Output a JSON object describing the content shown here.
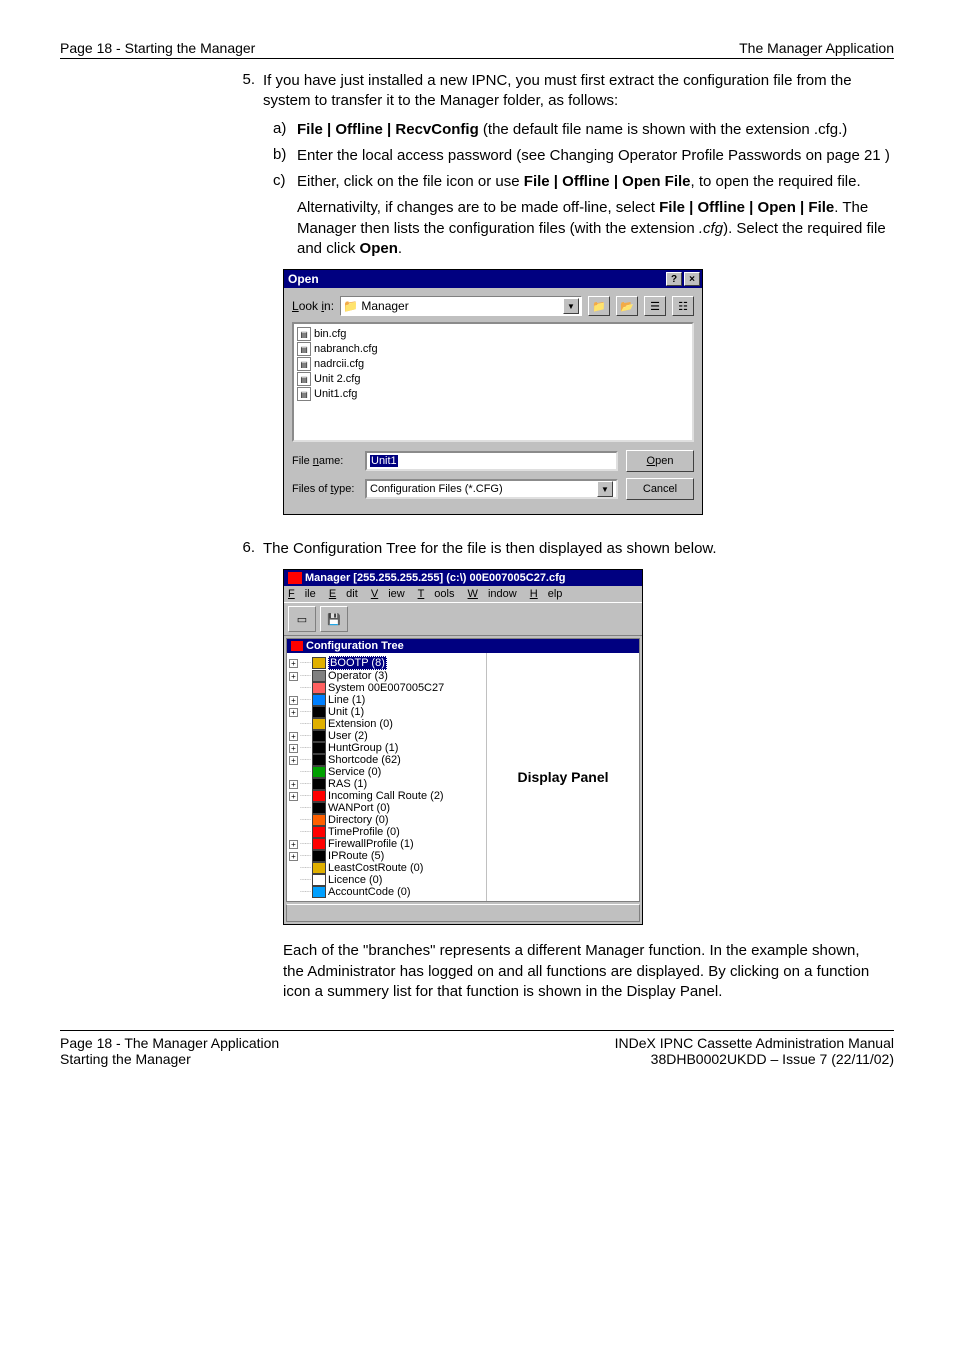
{
  "header": {
    "left": "Page 18 - Starting the Manager",
    "right": "The Manager Application"
  },
  "step5": {
    "num": "5.",
    "intro": "If you have just installed a new IPNC, you must first extract the configuration file from the system to transfer it to the Manager folder, as follows:",
    "a": {
      "letter": "a)",
      "b1": "File | Offline | RecvConfig",
      "rest": " (the default file name is shown with the extension .cfg.)"
    },
    "b": {
      "letter": "b)",
      "text": "Enter the local access password (see Changing Operator Profile Passwords on page 21 )"
    },
    "c": {
      "letter": "c)",
      "pre": "Either, click on the file icon or use ",
      "b1": "File | Offline | Open File",
      "post": ", to open the required file."
    },
    "c2a": "Alternativilty, if changes are to be made off-line, select ",
    "c2b1": "File | Offline | Open | File",
    "c2mid": ". The Manager then lists the configuration files (with the extension ",
    "c2i": ".cfg",
    "c2post": "). Select the required file and click ",
    "c2b2": "Open",
    "c2end": "."
  },
  "openDialog": {
    "title": "Open",
    "lookin_label": "Look in:",
    "lookin_value": "Manager",
    "files": [
      "bin.cfg",
      "nabranch.cfg",
      "nadrcii.cfg",
      "Unit 2.cfg",
      "Unit1.cfg"
    ],
    "filename_label": "File name:",
    "filename_value": "Unit1",
    "filetype_label": "Files of type:",
    "filetype_value": "Configuration Files (*.CFG)",
    "open_btn": "Open",
    "cancel_btn": "Cancel"
  },
  "step6": {
    "num": "6.",
    "text": "The Configuration Tree for the file is then displayed as shown below."
  },
  "mgr": {
    "title": "Manager [255.255.255.255] (c:\\) 00E007005C27.cfg",
    "menus": [
      "File",
      "Edit",
      "View",
      "Tools",
      "Window",
      "Help"
    ],
    "cfg_title": "Configuration Tree",
    "display_label": "Display Panel",
    "tree": [
      {
        "exp": "+",
        "label": "BOOTP (8)",
        "selected": true,
        "color": "#e0b000"
      },
      {
        "exp": "+",
        "label": "Operator (3)",
        "color": "#808080"
      },
      {
        "exp": "",
        "label": "System 00E007005C27",
        "color": "#ff6060"
      },
      {
        "exp": "+",
        "label": "Line (1)",
        "color": "#0080ff"
      },
      {
        "exp": "+",
        "label": "Unit (1)",
        "color": "#000"
      },
      {
        "exp": "",
        "label": "Extension (0)",
        "color": "#e0b000"
      },
      {
        "exp": "+",
        "label": "User (2)",
        "color": "#000"
      },
      {
        "exp": "+",
        "label": "HuntGroup (1)",
        "color": "#000"
      },
      {
        "exp": "+",
        "label": "Shortcode (62)",
        "color": "#000"
      },
      {
        "exp": "",
        "label": "Service (0)",
        "color": "#00a000"
      },
      {
        "exp": "+",
        "label": "RAS (1)",
        "color": "#000"
      },
      {
        "exp": "+",
        "label": "Incoming Call Route (2)",
        "color": "#ff0000"
      },
      {
        "exp": "",
        "label": "WANPort (0)",
        "color": "#000"
      },
      {
        "exp": "",
        "label": "Directory (0)",
        "color": "#ff6000"
      },
      {
        "exp": "",
        "label": "TimeProfile (0)",
        "color": "#ff0000"
      },
      {
        "exp": "+",
        "label": "FirewallProfile (1)",
        "color": "#ff0000"
      },
      {
        "exp": "+",
        "label": "IPRoute (5)",
        "color": "#000"
      },
      {
        "exp": "",
        "label": "LeastCostRoute (0)",
        "color": "#e0b000"
      },
      {
        "exp": "",
        "label": "Licence (0)",
        "color": "#fff"
      },
      {
        "exp": "",
        "label": "AccountCode (0)",
        "color": "#00a0ff"
      }
    ]
  },
  "closing": "Each of the \"branches\" represents a different Manager function. In the example shown, the Administrator has logged on and all functions are displayed. By clicking on a function icon a summery list for that function is shown in the Display Panel.",
  "footer": {
    "l1": "Page 18 - The Manager Application",
    "l2": "Starting the Manager",
    "r1": "INDeX IPNC Cassette Administration Manual",
    "r2": "38DHB0002UKDD – Issue 7 (22/11/02)"
  }
}
